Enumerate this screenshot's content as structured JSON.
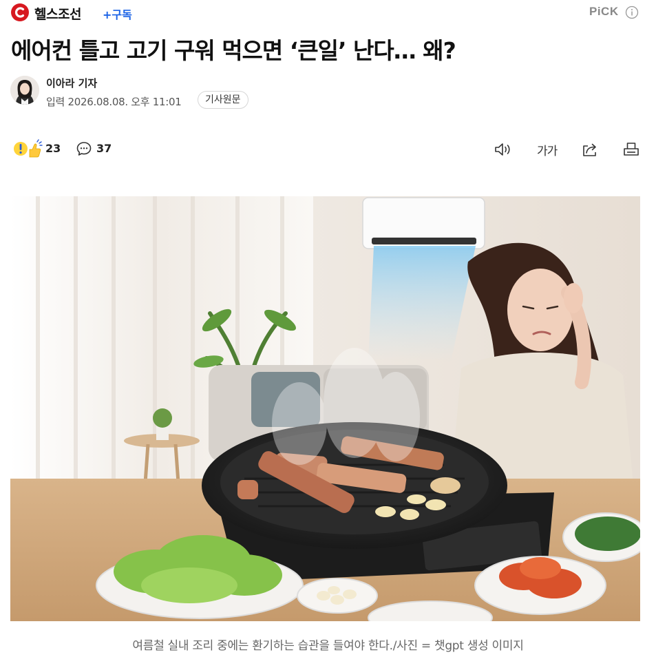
{
  "press": {
    "name": "헬스조선",
    "subscribe_label": "+구독",
    "brand_color": "#d71920"
  },
  "pick_label": "PiCK",
  "article": {
    "headline": "에어컨 틀고 고기 구워 먹으면 ‘큰일’ 난다… 왜?",
    "reporter": "이아라 기자",
    "datetime": "입력 2026.08.08. 오후 11:01",
    "original_button": "기사원문",
    "reaction_count": "23",
    "comment_count": "37",
    "font_size_label": "가가",
    "caption": "여름철 실내 조리 중에는 환기하는 습관을 들여야 한다./사진 = 챗gpt 생성 이미지"
  },
  "icons": {
    "reaction": "reaction-emoji-icon",
    "comment": "comment-icon",
    "listen": "speaker-icon",
    "font_size": "font-size-icon",
    "share": "share-icon",
    "print": "print-icon",
    "info": "info-icon"
  },
  "colors": {
    "accent_blue": "#1a62e6",
    "text_primary": "#111111",
    "text_secondary": "#666666"
  }
}
